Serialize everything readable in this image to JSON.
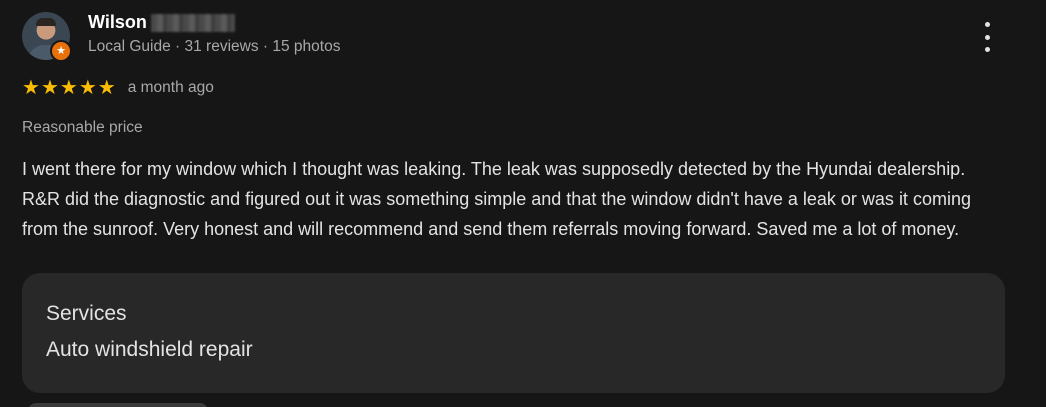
{
  "reviewer": {
    "name": "Wilson",
    "meta": "Local Guide · 31 reviews · 15 photos",
    "badge_icon": "local-guide-star-icon"
  },
  "review": {
    "rating": 5,
    "rating_max": 5,
    "star_glyph": "★",
    "time": "a month ago",
    "tag": "Reasonable price",
    "text": "I went there for my window which I thought was leaking. The leak was supposedly detected by the Hyundai dealership. R&R did the diagnostic and figured out it was something simple and that the window didn't have a leak or was it coming from the sunroof. Very honest and will recommend and send them referrals moving forward. Saved me a lot of money."
  },
  "services": {
    "title": "Services",
    "value": "Auto windshield repair"
  },
  "colors": {
    "background": "#161616",
    "card": "#282828",
    "star": "#fbbc04",
    "badge": "#e8710a",
    "muted_text": "#a8a8a8"
  }
}
